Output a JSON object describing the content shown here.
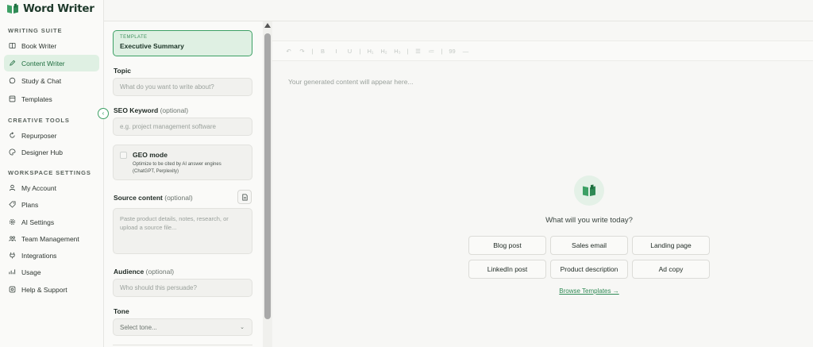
{
  "brand": {
    "name": "Word Writer"
  },
  "sidebar": {
    "sections": [
      {
        "title": "WRITING SUITE",
        "items": [
          {
            "label": "Book Writer",
            "icon": "book-icon"
          },
          {
            "label": "Content Writer",
            "icon": "pen-icon",
            "active": true
          },
          {
            "label": "Study & Chat",
            "icon": "chat-icon"
          },
          {
            "label": "Templates",
            "icon": "templates-icon"
          }
        ]
      },
      {
        "title": "CREATIVE TOOLS",
        "items": [
          {
            "label": "Repurposer",
            "icon": "refresh-icon"
          },
          {
            "label": "Designer Hub",
            "icon": "palette-icon"
          }
        ]
      },
      {
        "title": "WORKSPACE SETTINGS",
        "items": [
          {
            "label": "My Account",
            "icon": "user-icon"
          },
          {
            "label": "Plans",
            "icon": "tag-icon"
          },
          {
            "label": "AI Settings",
            "icon": "gear-icon"
          },
          {
            "label": "Team Management",
            "icon": "team-icon"
          },
          {
            "label": "Integrations",
            "icon": "plug-icon"
          },
          {
            "label": "Usage",
            "icon": "usage-icon"
          },
          {
            "label": "Help & Support",
            "icon": "help-icon"
          }
        ]
      }
    ]
  },
  "form": {
    "template_label": "TEMPLATE",
    "template_value": "Executive Summary",
    "topic_label": "Topic",
    "topic_placeholder": "What do you want to write about?",
    "seo_label": "SEO Keyword",
    "seo_optional": "(optional)",
    "seo_placeholder": "e.g. project management software",
    "geo_title": "GEO mode",
    "geo_desc": "Optimize to be cited by AI answer engines (ChatGPT, Perplexity)",
    "source_label": "Source content",
    "source_optional": "(optional)",
    "source_placeholder": "Paste product details, notes, research, or upload a source file...",
    "audience_label": "Audience",
    "audience_optional": "(optional)",
    "audience_placeholder": "Who should this persuade?",
    "tone_label": "Tone",
    "tone_value": "Select tone..."
  },
  "toolbar": {
    "items": [
      "↶",
      "↷",
      "|",
      "B",
      "I",
      "U",
      "|",
      "H₁",
      "H₂",
      "H₃",
      "|",
      "☰",
      "≔",
      "|",
      "99",
      "—"
    ]
  },
  "editor": {
    "placeholder": "Your generated content will appear here...",
    "question": "What will you write today?",
    "chips": [
      "Blog post",
      "Sales email",
      "Landing page",
      "LinkedIn post",
      "Product description",
      "Ad copy"
    ],
    "browse": "Browse Templates →"
  },
  "colors": {
    "accent": "#3da065",
    "accent_bg": "#dff0e3",
    "brand_dark": "#1f3a2c"
  }
}
